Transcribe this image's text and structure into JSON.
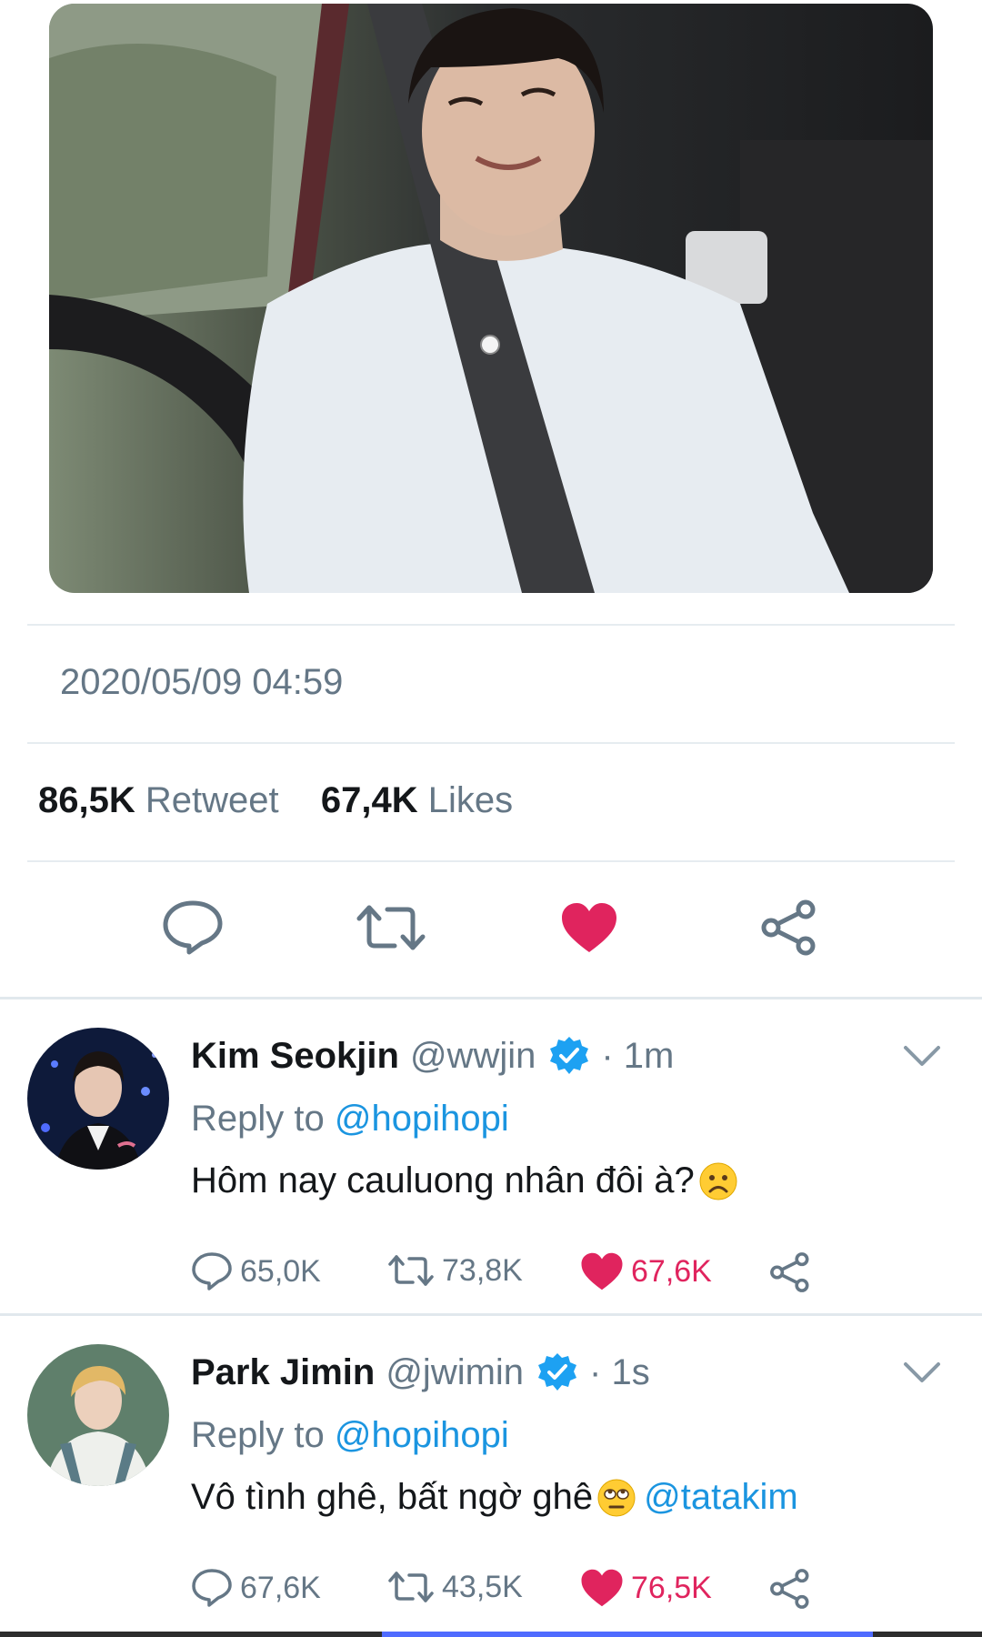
{
  "tweet": {
    "media_alt_icon": "photo-car-driver",
    "timestamp": "2020/05/09 04:59",
    "stats": {
      "retweets_count": "86,5K",
      "retweets_label": "Retweet",
      "likes_count": "67,4K",
      "likes_label": "Likes"
    },
    "actions": {
      "reply_icon": "comment-icon",
      "retweet_icon": "retweet-icon",
      "like_icon": "heart-icon",
      "share_icon": "share-icon"
    }
  },
  "replies": [
    {
      "name": "Kim Seokjin",
      "handle": "@wwjin",
      "time": "· 1m",
      "reply_to_label": "Reply to",
      "reply_to_handle": "@hopihopi",
      "text": "Hôm nay cauluong nhân đôi à?",
      "text_emoji": "frowning-face",
      "text_mention": "",
      "counts": {
        "replies": "65,0K",
        "retweets": "73,8K",
        "likes": "67,6K"
      }
    },
    {
      "name": "Park Jimin",
      "handle": "@jwimin",
      "time": "· 1s",
      "reply_to_label": "Reply to",
      "reply_to_handle": "@hopihopi",
      "text": "Vô tình ghê, bất ngờ ghê",
      "text_emoji": "eye-roll-face",
      "text_mention": "@tatakim",
      "counts": {
        "replies": "67,6K",
        "retweets": "43,5K",
        "likes": "76,5K"
      }
    }
  ],
  "colors": {
    "like_red": "#e0245e",
    "verified_blue": "#1da1f2",
    "link_blue": "#1b95e0",
    "muted_gray": "#657786"
  }
}
